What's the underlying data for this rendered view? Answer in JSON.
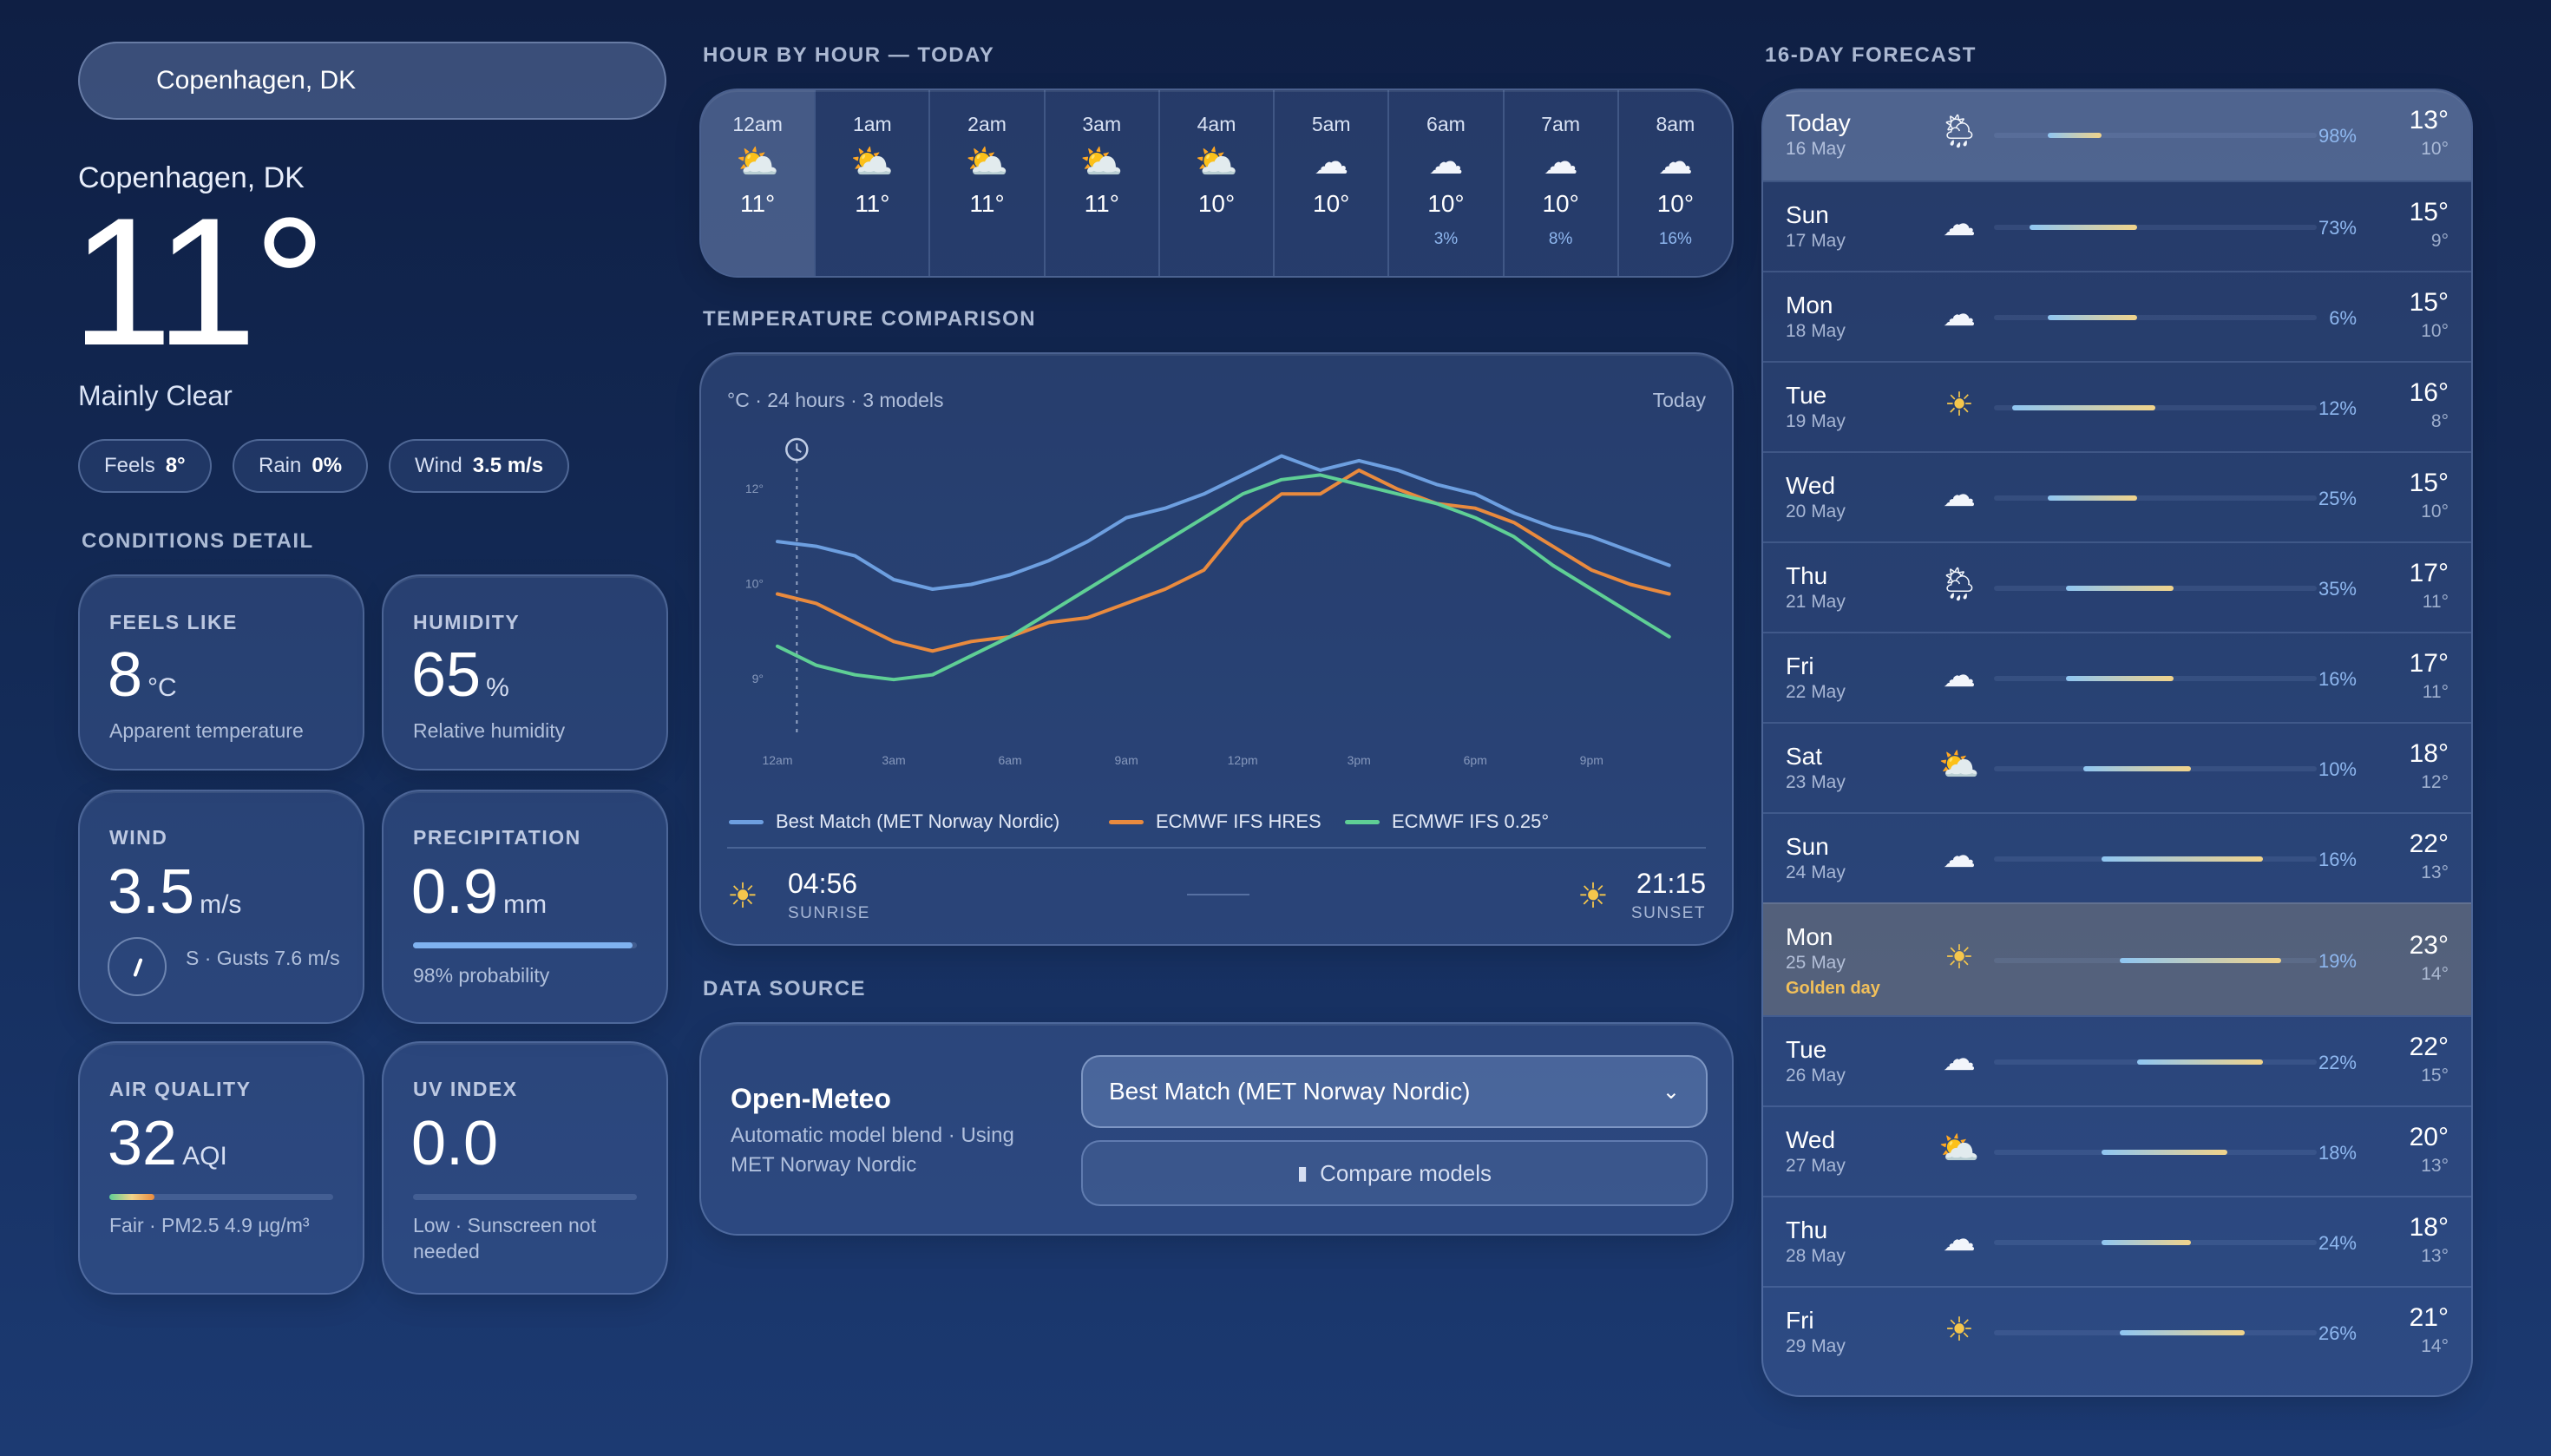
{
  "search": {
    "value": "Copenhagen, DK"
  },
  "current": {
    "location": "Copenhagen, DK",
    "temp": "11°",
    "condition": "Mainly Clear",
    "pills": [
      {
        "label": "Feels",
        "value": "8°"
      },
      {
        "label": "Rain",
        "value": "0%"
      },
      {
        "label": "Wind",
        "value": "3.5 m/s"
      }
    ]
  },
  "conditions": {
    "section_title": "CONDITIONS DETAIL",
    "feels_like": {
      "title": "FEELS LIKE",
      "value": "8",
      "unit": "°C",
      "sub": "Apparent temperature"
    },
    "humidity": {
      "title": "HUMIDITY",
      "value": "65",
      "unit": "%",
      "sub": "Relative humidity"
    },
    "wind": {
      "title": "WIND",
      "value": "3.5",
      "unit": "m/s",
      "sub": "S · Gusts 7.6 m/s"
    },
    "precipitation": {
      "title": "PRECIPITATION",
      "value": "0.9",
      "unit": "mm",
      "sub": "98% probability",
      "probability": 0.98
    },
    "air_quality": {
      "title": "AIR QUALITY",
      "value": "32",
      "unit": "AQI",
      "sub": "Fair · PM2.5 4.9 µg/m³",
      "level": 0.2
    },
    "uv_index": {
      "title": "UV INDEX",
      "value": "0.0",
      "unit": "",
      "sub": "Low · Sunscreen not needed",
      "level": 0.0
    }
  },
  "hourly": {
    "section_title": "HOUR BY HOUR — TODAY",
    "hours": [
      {
        "time": "12am",
        "icon": "partly-cloudy-icon",
        "glyph": "⛅",
        "temp": "11°",
        "precip": ""
      },
      {
        "time": "1am",
        "icon": "partly-cloudy-icon",
        "glyph": "⛅",
        "temp": "11°",
        "precip": ""
      },
      {
        "time": "2am",
        "icon": "partly-cloudy-icon",
        "glyph": "⛅",
        "temp": "11°",
        "precip": ""
      },
      {
        "time": "3am",
        "icon": "partly-cloudy-icon",
        "glyph": "⛅",
        "temp": "11°",
        "precip": ""
      },
      {
        "time": "4am",
        "icon": "partly-cloudy-icon",
        "glyph": "⛅",
        "temp": "10°",
        "precip": ""
      },
      {
        "time": "5am",
        "icon": "cloud-icon",
        "glyph": "☁",
        "temp": "10°",
        "precip": ""
      },
      {
        "time": "6am",
        "icon": "cloud-icon",
        "glyph": "☁",
        "temp": "10°",
        "precip": "3%"
      },
      {
        "time": "7am",
        "icon": "cloud-icon",
        "glyph": "☁",
        "temp": "10°",
        "precip": "8%"
      },
      {
        "time": "8am",
        "icon": "cloud-icon",
        "glyph": "☁",
        "temp": "10°",
        "precip": "16%"
      }
    ]
  },
  "comparison": {
    "section_title": "TEMPERATURE COMPARISON",
    "subtitle": "°C · 24 hours · 3 models",
    "period": "Today",
    "sunrise": {
      "time": "04:56",
      "label": "SUNRISE"
    },
    "sunset": {
      "time": "21:15",
      "label": "SUNSET"
    }
  },
  "chart_data": {
    "type": "line",
    "title": "",
    "xlabel": "",
    "ylabel": "",
    "x": [
      0,
      1,
      2,
      3,
      4,
      5,
      6,
      7,
      8,
      9,
      10,
      11,
      12,
      13,
      14,
      15,
      16,
      17,
      18,
      19,
      20,
      21,
      22,
      23
    ],
    "x_tick_labels": [
      "12am",
      "3am",
      "6am",
      "9am",
      "12pm",
      "3pm",
      "6pm",
      "9pm"
    ],
    "x_ticks": [
      0,
      3,
      6,
      9,
      12,
      15,
      18,
      21
    ],
    "y_tick_labels": [
      "12°",
      "10°",
      "9°"
    ],
    "y_ticks": [
      12,
      10,
      8
    ],
    "ylim": [
      7.0,
      13.2
    ],
    "grid": false,
    "legend": "bottom",
    "series": [
      {
        "name": "Best Match (MET Norway Nordic)",
        "color": "#6d9fe0",
        "values": [
          10.9,
          10.8,
          10.6,
          10.1,
          9.9,
          10.0,
          10.2,
          10.5,
          10.9,
          11.4,
          11.6,
          11.9,
          12.3,
          12.7,
          12.4,
          12.6,
          12.4,
          12.1,
          11.9,
          11.5,
          11.2,
          11.0,
          10.7,
          10.4
        ]
      },
      {
        "name": "ECMWF IFS HRES",
        "color": "#e98a3e",
        "values": [
          9.8,
          9.6,
          9.2,
          8.8,
          8.6,
          8.8,
          8.9,
          9.2,
          9.3,
          9.6,
          9.9,
          10.3,
          11.3,
          11.9,
          11.9,
          12.4,
          12.0,
          11.7,
          11.6,
          11.3,
          10.8,
          10.3,
          10.0,
          9.8
        ]
      },
      {
        "name": "ECMWF IFS 0.25°",
        "color": "#5fcf95",
        "values": [
          8.7,
          8.3,
          8.1,
          8.0,
          8.1,
          8.5,
          8.9,
          9.4,
          9.9,
          10.4,
          10.9,
          11.4,
          11.9,
          12.2,
          12.3,
          12.1,
          11.9,
          11.7,
          11.4,
          11.0,
          10.4,
          9.9,
          9.4,
          8.9
        ]
      }
    ],
    "marker": {
      "label": "now",
      "x": 0.5
    }
  },
  "data_source": {
    "section_title": "DATA SOURCE",
    "title": "Open-Meteo",
    "description": "Automatic model blend · Using MET Norway Nordic",
    "selected_model": "Best Match (MET Norway Nordic)",
    "compare_label": "Compare models"
  },
  "forecast": {
    "section_title": "16-DAY FORECAST",
    "range": [
      7,
      25
    ],
    "days": [
      {
        "day": "Today",
        "date": "16 May",
        "note": "",
        "icon": "rain-cloud-icon",
        "glyph": "🌦",
        "precip": "98%",
        "hi": "13°",
        "lo": "10°",
        "hi_n": 13,
        "lo_n": 10
      },
      {
        "day": "Sun",
        "date": "17 May",
        "note": "",
        "icon": "cloud-icon",
        "glyph": "☁",
        "precip": "73%",
        "hi": "15°",
        "lo": "9°",
        "hi_n": 15,
        "lo_n": 9
      },
      {
        "day": "Mon",
        "date": "18 May",
        "note": "",
        "icon": "cloud-icon",
        "glyph": "☁",
        "precip": "6%",
        "hi": "15°",
        "lo": "10°",
        "hi_n": 15,
        "lo_n": 10
      },
      {
        "day": "Tue",
        "date": "19 May",
        "note": "",
        "icon": "sun-icon",
        "glyph": "☀",
        "precip": "12%",
        "hi": "16°",
        "lo": "8°",
        "hi_n": 16,
        "lo_n": 8
      },
      {
        "day": "Wed",
        "date": "20 May",
        "note": "",
        "icon": "cloud-icon",
        "glyph": "☁",
        "precip": "25%",
        "hi": "15°",
        "lo": "10°",
        "hi_n": 15,
        "lo_n": 10
      },
      {
        "day": "Thu",
        "date": "21 May",
        "note": "",
        "icon": "rain-cloud-icon",
        "glyph": "🌦",
        "precip": "35%",
        "hi": "17°",
        "lo": "11°",
        "hi_n": 17,
        "lo_n": 11
      },
      {
        "day": "Fri",
        "date": "22 May",
        "note": "",
        "icon": "cloud-icon",
        "glyph": "☁",
        "precip": "16%",
        "hi": "17°",
        "lo": "11°",
        "hi_n": 17,
        "lo_n": 11
      },
      {
        "day": "Sat",
        "date": "23 May",
        "note": "",
        "icon": "partly-cloudy-icon",
        "glyph": "⛅",
        "precip": "10%",
        "hi": "18°",
        "lo": "12°",
        "hi_n": 18,
        "lo_n": 12
      },
      {
        "day": "Sun",
        "date": "24 May",
        "note": "",
        "icon": "cloud-icon",
        "glyph": "☁",
        "precip": "16%",
        "hi": "22°",
        "lo": "13°",
        "hi_n": 22,
        "lo_n": 13
      },
      {
        "day": "Mon",
        "date": "25 May",
        "note": "Golden day",
        "icon": "sun-icon",
        "glyph": "☀",
        "precip": "19%",
        "hi": "23°",
        "lo": "14°",
        "hi_n": 23,
        "lo_n": 14
      },
      {
        "day": "Tue",
        "date": "26 May",
        "note": "",
        "icon": "cloud-icon",
        "glyph": "☁",
        "precip": "22%",
        "hi": "22°",
        "lo": "15°",
        "hi_n": 22,
        "lo_n": 15
      },
      {
        "day": "Wed",
        "date": "27 May",
        "note": "",
        "icon": "partly-cloudy-icon",
        "glyph": "⛅",
        "precip": "18%",
        "hi": "20°",
        "lo": "13°",
        "hi_n": 20,
        "lo_n": 13
      },
      {
        "day": "Thu",
        "date": "28 May",
        "note": "",
        "icon": "cloud-icon",
        "glyph": "☁",
        "precip": "24%",
        "hi": "18°",
        "lo": "13°",
        "hi_n": 18,
        "lo_n": 13
      },
      {
        "day": "Fri",
        "date": "29 May",
        "note": "",
        "icon": "sun-icon",
        "glyph": "☀",
        "precip": "26%",
        "hi": "21°",
        "lo": "14°",
        "hi_n": 21,
        "lo_n": 14
      }
    ]
  }
}
